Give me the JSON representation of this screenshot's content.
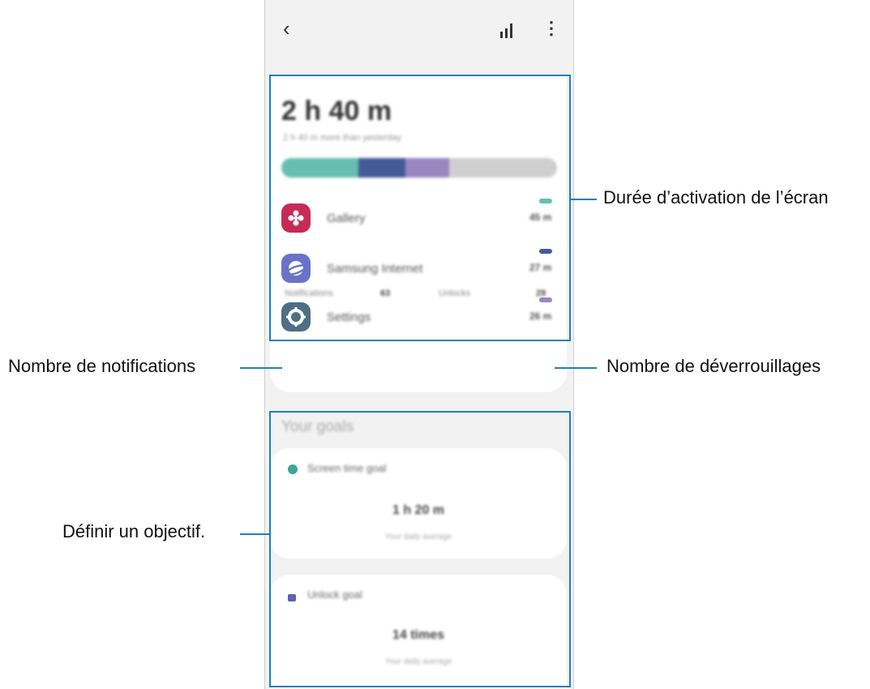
{
  "topbar": {
    "back_glyph": "‹",
    "more_glyph": "⋮",
    "icons": [
      "back-icon",
      "bar-chart-icon",
      "more-options-icon"
    ]
  },
  "screen_time": {
    "total": "2 h 40 m",
    "subtitle": "2 h 40 m more than yesterday",
    "usage_bar": [
      {
        "color": "#66bfb1",
        "fraction": 0.28
      },
      {
        "color": "#445a99",
        "fraction": 0.17
      },
      {
        "color": "#9a87c2",
        "fraction": 0.16
      },
      {
        "color": "#cfcfcf",
        "fraction": 0.39
      }
    ],
    "apps": [
      {
        "name": "Gallery",
        "time": "45 m",
        "icon_color": "#c72a57",
        "pill_color": "#66bfb1",
        "icon": "flower-icon"
      },
      {
        "name": "Samsung Internet",
        "time": "27 m",
        "icon_color": "#6a73c9",
        "pill_color": "#445a99",
        "icon": "planet-icon"
      },
      {
        "name": "Settings",
        "time": "26 m",
        "icon_color": "#4f6f84",
        "pill_color": "#9a87c2",
        "icon": "gear-icon"
      }
    ]
  },
  "stats": {
    "notifications_label": "Notifications",
    "notifications_value": "63",
    "unlocks_label": "Unlocks",
    "unlocks_value": "29"
  },
  "goals": {
    "title": "Your goals",
    "screen_time_goal": {
      "label": "Screen time goal",
      "value": "1 h 20 m",
      "sub": "Your daily average",
      "icon": "clock-icon",
      "icon_color": "#3aa896"
    },
    "unlock_goal": {
      "label": "Unlock goal",
      "value": "14 times",
      "sub": "Your daily average",
      "icon": "unlock-icon",
      "icon_color": "#5b62b8"
    }
  },
  "callouts": {
    "screen_time": "Durée d’activation de l’écran",
    "notifications": "Nombre de notifications",
    "unlocks": "Nombre de déverrouillages",
    "goal": "Définir un objectif."
  },
  "colors": {
    "highlight": "#1e7fc0"
  }
}
